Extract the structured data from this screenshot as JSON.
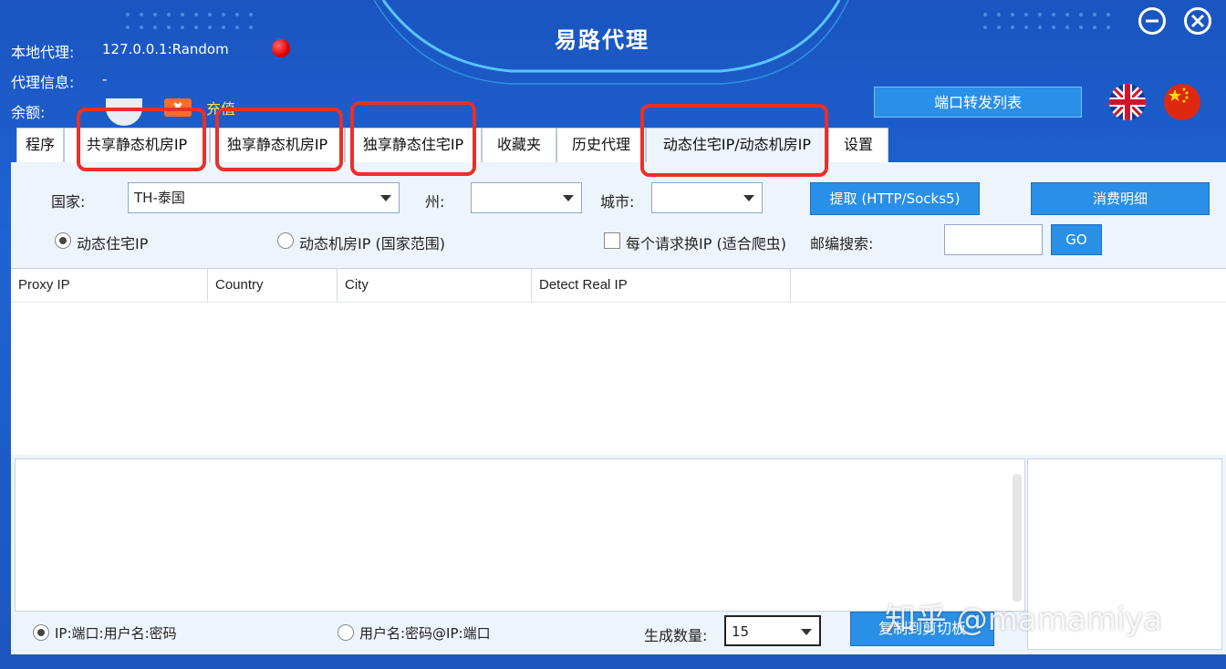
{
  "window": {
    "title": "易路代理"
  },
  "header": {
    "local_proxy_label": "本地代理:",
    "local_proxy_value": "127.0.0.1:Random",
    "proxy_info_label": "代理信息:",
    "proxy_info_value": "-",
    "balance_label": "余额:",
    "recharge_label": "充值",
    "port_forward_button": "端口转发列表"
  },
  "tabs": [
    {
      "label": "程序"
    },
    {
      "label": "共享静态机房IP"
    },
    {
      "label": "独享静态机房IP"
    },
    {
      "label": "独享静态住宅IP"
    },
    {
      "label": "收藏夹"
    },
    {
      "label": "历史代理"
    },
    {
      "label": "动态住宅IP/动态机房IP",
      "active": true
    },
    {
      "label": "设置"
    }
  ],
  "filters": {
    "country_label": "国家:",
    "country_value": "TH-泰国",
    "state_label": "州:",
    "state_value": "",
    "city_label": "城市:",
    "city_value": "",
    "extract_button": "提取 (HTTP/Socks5)",
    "consumption_button": "消费明细",
    "radio_residential": "动态住宅IP",
    "radio_datacenter": "动态机房IP (国家范围)",
    "checkbox_rotate": "每个请求换IP (适合爬虫)",
    "zip_label": "邮编搜索:",
    "go_button": "GO"
  },
  "table": {
    "columns": [
      "Proxy IP",
      "Country",
      "City",
      "Detect Real IP"
    ]
  },
  "bottom": {
    "format1": "IP:端口:用户名:密码",
    "format2": "用户名:密码@IP:端口",
    "count_label": "生成数量:",
    "count_value": "15",
    "copy_button": "复制到剪切板"
  },
  "watermark": "知乎 @mamamiya",
  "colors": {
    "background": "#1e63d3",
    "accent_button": "#2a8fe6",
    "highlight_red": "#e8302a",
    "recharge": "#ffe14a"
  }
}
